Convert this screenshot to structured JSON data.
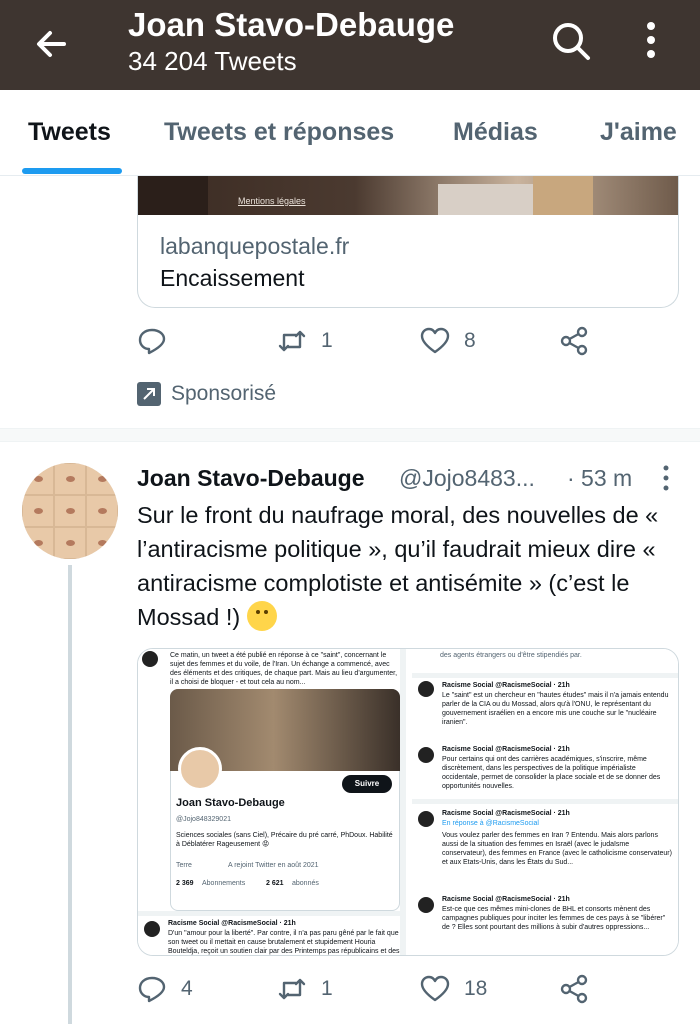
{
  "header": {
    "title": "Joan Stavo-Debauge",
    "subtitle": "34 204 Tweets"
  },
  "tabs": [
    "Tweets",
    "Tweets et réponses",
    "Médias",
    "J'aime"
  ],
  "ad": {
    "image_text": "Mentions légales",
    "domain": "labanquepostale.fr",
    "title": "Encaissement",
    "stats": {
      "replies": "",
      "retweets": "1",
      "likes": "8"
    },
    "sponsored_label": "Sponsorisé"
  },
  "tweet": {
    "name": "Joan Stavo-Debauge",
    "handle": "@Jojo8483...",
    "time": "· 53 m",
    "text": "Sur le front du naufrage moral, des nouvelles de « l’antiracisme politique », qu’il faudrait mieux dire « antiracisme complotiste et antisémite » (c’est le Mossad !)",
    "stats": {
      "replies": "4",
      "retweets": "1",
      "likes": "18"
    },
    "media": {
      "left": {
        "intro": "Ce matin, un tweet a été publié en réponse à ce \"saint\", concernant le sujet des femmes et du voile, de l'Iran. Un échange a commencé, avec des éléments et des critiques, de chaque part. Mais au lieu d'argumenter, il a choisi de bloquer - et tout cela au nom...",
        "profile_name": "Joan Stavo-Debauge",
        "profile_handle": "@Jojo848329021",
        "follow_label": "Suivre",
        "bio": "Sciences sociales (sans Ciel), Précaire du pré carré, PhDoux. Habilité à Déblatérer Rageusement 😡",
        "location": "Terre",
        "joined": "A rejoint Twitter en août 2021",
        "following": "2 369",
        "following_label": "Abonnements",
        "followers": "2 621",
        "followers_label": "abonnés",
        "reply_author": "Racisme Social @RacismeSocial · 21h",
        "reply_text": "D'un \"amour pour la liberté\". Par contre, il n'a pas paru gêné par le fait que son tweet ou il mettait en cause brutalement et stupidement Houria Bouteldja, reçoit un soutien clair par des Printemps pas républicains et des"
      },
      "right": {
        "top_text": "des agents étrangers ou d'être stipendiés par.",
        "posts": [
          {
            "author": "Racisme Social @RacismeSocial · 21h",
            "text": "Le \"saint\" est un chercheur en \"hautes études\" mais il n'a jamais entendu parler de la CIA ou du Mossad, alors qu'à l'ONU, le représentant du gouvernement israélien en a encore mis une couche sur le \"nucléaire iranien\"."
          },
          {
            "author": "Racisme Social @RacismeSocial · 21h",
            "text": "Pour certains qui ont des carrières académiques, s'inscrire, même discrètement, dans les perspectives de la politique impérialiste occidentale, permet de consolider la place sociale et de se donner des opportunités nouvelles."
          },
          {
            "author": "Racisme Social @RacismeSocial · 21h",
            "reply_to": "En réponse à @RacismeSocial",
            "text": "Vous voulez parler des femmes en Iran ? Entendu. Mais alors parlons aussi de la situation des femmes en Israël (avec le judaïsme conservateur), des femmes en France (avec le catholicisme conservateur) et aux Etats-Unis, dans les États du Sud..."
          },
          {
            "author": "Racisme Social @RacismeSocial · 21h",
            "text": "Est-ce que ces mêmes mini-clones de BHL et consorts mènent des campagnes publiques pour inciter les femmes de ces pays à se \"libérer\" de ? Elles sont pourtant des millions à subir d'autres oppressions..."
          }
        ]
      }
    }
  },
  "colors": {
    "header_bg": "#3e3530",
    "accent": "#1d9bf0",
    "muted": "#536471"
  }
}
